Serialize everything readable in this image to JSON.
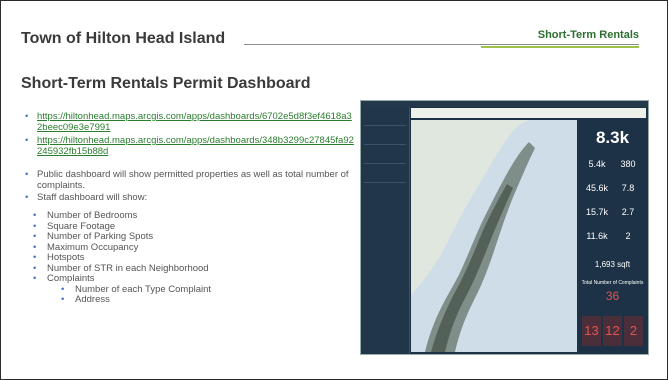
{
  "header": {
    "org_title": "Town of Hilton Head Island",
    "section_label": "Short-Term Rentals"
  },
  "main": {
    "title": "Short-Term Rentals Permit Dashboard",
    "links": [
      "https://hiltonhead.maps.arcgis.com/apps/dashboards/6702e5d8f3ef4618a32beec09e3e7991",
      "https://hiltonhead.maps.arcgis.com/apps/dashboards/348b3299c27845fa92245932fb15b88d"
    ],
    "bullets": [
      "Public dashboard will show permitted properties as well as total number of complaints.",
      "Staff dashboard will show:"
    ],
    "staff_items": [
      "Number of Bedrooms",
      "Square Footage",
      "Number of Parking Spots",
      "Maximum Occupancy",
      "Hotspots",
      "Number of STR in each Neighborhood",
      "Complaints"
    ],
    "complaint_items": [
      "Number of each Type Complaint",
      "Address"
    ]
  },
  "dashboard_screenshot": {
    "top_stat": "8.3k",
    "stats": [
      {
        "left": "5.4k",
        "right": "380"
      },
      {
        "left": "45.6k",
        "right": "7.8"
      },
      {
        "left": "15.7k",
        "right": "2.7"
      },
      {
        "left": "11.6k",
        "right": "2"
      }
    ],
    "sqft_value": "1,693 sqft",
    "complaints_label": "Total Number of Complaints",
    "complaints_total": "36",
    "complaint_breakdown": [
      "13",
      "12",
      "2"
    ]
  },
  "colors": {
    "accent_green": "#2c6e2f",
    "link_green": "#2a7d2e",
    "bullet_blue": "#4472c4",
    "dashboard_navy": "#1d3246",
    "complaint_red": "#e35352"
  }
}
